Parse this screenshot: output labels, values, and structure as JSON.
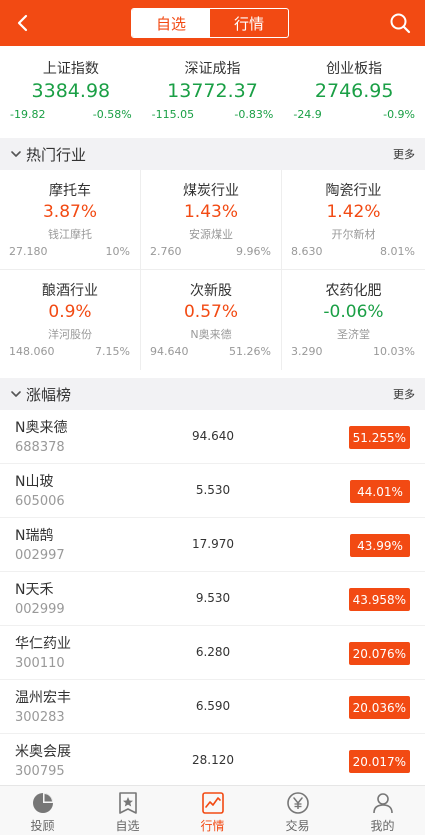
{
  "colors": {
    "accent": "#f24a13",
    "up": "#f24a13",
    "down": "#1a9f45"
  },
  "header": {
    "tabs": [
      {
        "label": "自选",
        "active": true
      },
      {
        "label": "行情",
        "active": false
      }
    ],
    "back_icon": "back-arrow-icon",
    "search_icon": "search-icon"
  },
  "indices": [
    {
      "name": "上证指数",
      "value": "3384.98",
      "change": "-19.82",
      "pct": "-0.58%"
    },
    {
      "name": "深证成指",
      "value": "13772.37",
      "change": "-115.05",
      "pct": "-0.83%"
    },
    {
      "name": "创业板指",
      "value": "2746.95",
      "change": "-24.9",
      "pct": "-0.9%"
    }
  ],
  "hot_industries": {
    "title": "热门行业",
    "more": "更多",
    "items": [
      {
        "name": "摩托车",
        "pct": "3.87%",
        "stock": "钱江摩托",
        "price": "27.180",
        "ratio": "10%",
        "dir": "up"
      },
      {
        "name": "煤炭行业",
        "pct": "1.43%",
        "stock": "安源煤业",
        "price": "2.760",
        "ratio": "9.96%",
        "dir": "up"
      },
      {
        "name": "陶瓷行业",
        "pct": "1.42%",
        "stock": "开尔新材",
        "price": "8.630",
        "ratio": "8.01%",
        "dir": "up"
      },
      {
        "name": "酿酒行业",
        "pct": "0.9%",
        "stock": "洋河股份",
        "price": "148.060",
        "ratio": "7.15%",
        "dir": "up"
      },
      {
        "name": "次新股",
        "pct": "0.57%",
        "stock": "N奥来德",
        "price": "94.640",
        "ratio": "51.26%",
        "dir": "up"
      },
      {
        "name": "农药化肥",
        "pct": "-0.06%",
        "stock": "圣济堂",
        "price": "3.290",
        "ratio": "10.03%",
        "dir": "down"
      }
    ]
  },
  "gainers": {
    "title": "涨幅榜",
    "more": "更多",
    "rows": [
      {
        "name": "N奥来德",
        "code": "688378",
        "price": "94.640",
        "pct": "51.255%"
      },
      {
        "name": "N山玻",
        "code": "605006",
        "price": "5.530",
        "pct": "44.01%"
      },
      {
        "name": "N瑞鹄",
        "code": "002997",
        "price": "17.970",
        "pct": "43.99%"
      },
      {
        "name": "N天禾",
        "code": "002999",
        "price": "9.530",
        "pct": "43.958%"
      },
      {
        "name": "华仁药业",
        "code": "300110",
        "price": "6.280",
        "pct": "20.076%"
      },
      {
        "name": "温州宏丰",
        "code": "300283",
        "price": "6.590",
        "pct": "20.036%"
      },
      {
        "name": "米奥会展",
        "code": "300795",
        "price": "28.120",
        "pct": "20.017%"
      }
    ]
  },
  "tabbar": [
    {
      "label": "投顾",
      "icon": "pie-chart-icon",
      "active": false
    },
    {
      "label": "自选",
      "icon": "star-bookmark-icon",
      "active": false
    },
    {
      "label": "行情",
      "icon": "trend-chart-icon",
      "active": true
    },
    {
      "label": "交易",
      "icon": "yen-coin-icon",
      "active": false
    },
    {
      "label": "我的",
      "icon": "user-icon",
      "active": false
    }
  ]
}
